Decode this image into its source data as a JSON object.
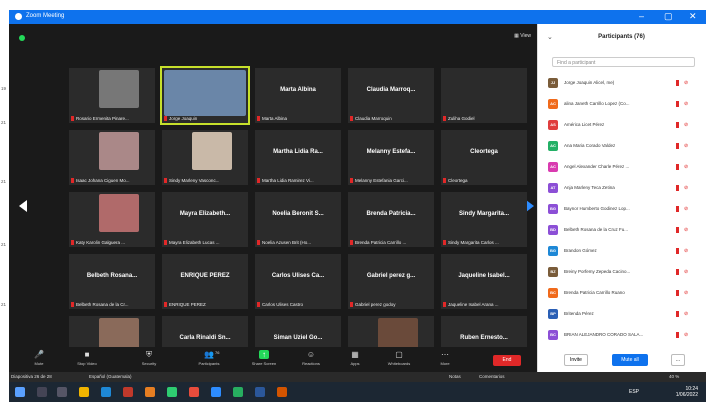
{
  "window": {
    "title": "Zoom Meeting"
  },
  "view": {
    "label": "View"
  },
  "gallery": {
    "tiles": [
      {
        "name": "",
        "caption": "Rosario Ermenita Pinare..."
      },
      {
        "name": "",
        "caption": "Jorge Joaquin"
      },
      {
        "name": "Marta Albina",
        "caption": "Marta Albina"
      },
      {
        "name": "Claudia Marroq...",
        "caption": "Claudia Marroquin"
      },
      {
        "name": "",
        "caption": "Zuliha Godiel"
      },
      {
        "name": "",
        "caption": "Isaac Johana Ciguen Mo..."
      },
      {
        "name": "",
        "caption": "Sindy Marleny Vasconc..."
      },
      {
        "name": "Martha Lidia Ra...",
        "caption": "Martha Lidia Ramirez Vi..."
      },
      {
        "name": "Melanny Estefa...",
        "caption": "Melanny Estefania Garci..."
      },
      {
        "name": "Cleortega",
        "caption": "Cleortega"
      },
      {
        "name": "",
        "caption": "Katy Karolin Galguera ..."
      },
      {
        "name": "Mayra Elizabeth...",
        "caption": "Mayra Elizabeth Lucas ..."
      },
      {
        "name": "Noelia Beronit S...",
        "caption": "Noelia Azusen Brit (Ho..."
      },
      {
        "name": "Brenda Patricia...",
        "caption": "Brenda Patricia Carrillo ..."
      },
      {
        "name": "Sindy Margarita...",
        "caption": "Sindy Margarita Carlos ..."
      },
      {
        "name": "Belbeth Rosana...",
        "caption": "Belbeth Rosana de la Cr..."
      },
      {
        "name": "ENRIQUE PEREZ",
        "caption": "ENRIQUE PEREZ"
      },
      {
        "name": "Carlos Ulises Ca...",
        "caption": "Carlos Ulises Castro"
      },
      {
        "name": "Gabriel perez g...",
        "caption": "Gabriel perez godoy"
      },
      {
        "name": "Jaqueline Isabel...",
        "caption": "Jaqueline Isabel Arana ..."
      },
      {
        "name": "",
        "caption": "Lesly Mendoza"
      },
      {
        "name": "Carla Rinaldi Sn...",
        "caption": "Carla Rinaldi Enriquez A..."
      },
      {
        "name": "Siman Uziel Go...",
        "caption": "Siman Uziel Gomez Ga..."
      },
      {
        "name": "",
        "caption": "Andrea Claudina Speed ..."
      },
      {
        "name": "Ruben Ernesto...",
        "caption": "Ruben Ernesto Guerra G..."
      }
    ]
  },
  "toolbar": {
    "items": [
      {
        "label": "Mute",
        "icon": "microphone-icon"
      },
      {
        "label": "Stop Video",
        "icon": "video-camera-icon"
      },
      {
        "label": "Security",
        "icon": "shield-icon"
      },
      {
        "label": "Participants",
        "icon": "participants-icon",
        "count": "76"
      },
      {
        "label": "Share Screen",
        "icon": "share-screen-icon"
      },
      {
        "label": "Reactions",
        "icon": "smile-icon"
      },
      {
        "label": "Apps",
        "icon": "apps-icon"
      },
      {
        "label": "Whiteboards",
        "icon": "whiteboard-icon"
      },
      {
        "label": "More",
        "icon": "more-icon"
      }
    ],
    "end_label": "End"
  },
  "participants_panel": {
    "title": "Participants (76)",
    "search_placeholder": "Find a participant",
    "list": [
      {
        "initials": "JJ",
        "name": "Jorge Joaquin Alicel, me)",
        "color": "#7a5c3a"
      },
      {
        "initials": "AC",
        "name": "alina Janeth Carrillo Lopez (Co...",
        "color": "#f06a1b"
      },
      {
        "initials": "AS",
        "name": "América Licet Pérez",
        "color": "#e03e3e"
      },
      {
        "initials": "AC",
        "name": "Ana Maria Corado Valdez",
        "color": "#23b066"
      },
      {
        "initials": "AC",
        "name": "Angel Alexander Charle Pérez ...",
        "color": "#d93bb0"
      },
      {
        "initials": "AT",
        "name": "Anja Marleny Teca Zetina",
        "color": "#8c4fd6"
      },
      {
        "initials": "BG",
        "name": "Baynor Humberto Godinez Lop...",
        "color": "#8c4fd6"
      },
      {
        "initials": "BD",
        "name": "Belbeth Rosana de la Cruz Fu...",
        "color": "#8c4fd6"
      },
      {
        "initials": "BG",
        "name": "Brandon Gómez",
        "color": "#1e88d6"
      },
      {
        "initials": "BZ",
        "name": "Breiny Porfemy Zepeda Cacino...",
        "color": "#7a5c3a"
      },
      {
        "initials": "BC",
        "name": "Brenda Patricia Carrillo Ruano",
        "color": "#f06a1b"
      },
      {
        "initials": "BP",
        "name": "Britenda Pérez",
        "color": "#2a5fb5"
      },
      {
        "initials": "BC",
        "name": "BRIAN ALEJANDRO CORADO SALA...",
        "color": "#8c4fd6"
      }
    ],
    "invite_label": "Invite",
    "mute_all_label": "Mute all",
    "more_label": "..."
  },
  "status_bar": {
    "left": "Diapositiva 26 de 28",
    "lang": "Español (Guatemala)",
    "notes": "Notas",
    "comments": "Comentarios",
    "zoom": "40 %"
  },
  "taskbar": {
    "time": "10:24",
    "date": "1/06/2022",
    "lang": "ESP"
  },
  "colors": {
    "accent": "#0e72ed",
    "end_red": "#e02828",
    "active_outline": "#c7e02b",
    "share_green": "#23d959"
  }
}
